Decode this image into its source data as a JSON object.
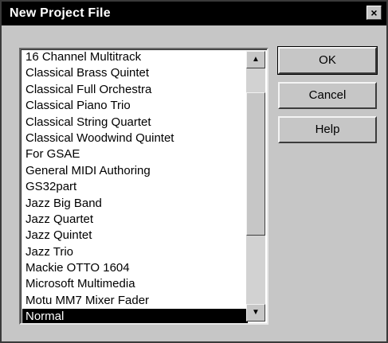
{
  "dialog": {
    "title": "New Project File",
    "close_label": "×"
  },
  "list": {
    "items": [
      "16 Channel Multitrack",
      "Classical Brass Quintet",
      "Classical Full Orchestra",
      "Classical Piano Trio",
      "Classical String Quartet",
      "Classical Woodwind Quintet",
      "For GSAE",
      "General MIDI Authoring",
      "GS32part",
      "Jazz Big Band",
      "Jazz Quartet",
      "Jazz Quintet",
      "Jazz Trio",
      "Mackie OTTO 1604",
      "Microsoft Multimedia",
      "Motu MM7 Mixer Fader",
      "Normal"
    ],
    "selected": "Normal",
    "scroll_up": "▲",
    "scroll_down": "▼"
  },
  "buttons": {
    "ok": "OK",
    "cancel": "Cancel",
    "help": "Help"
  }
}
